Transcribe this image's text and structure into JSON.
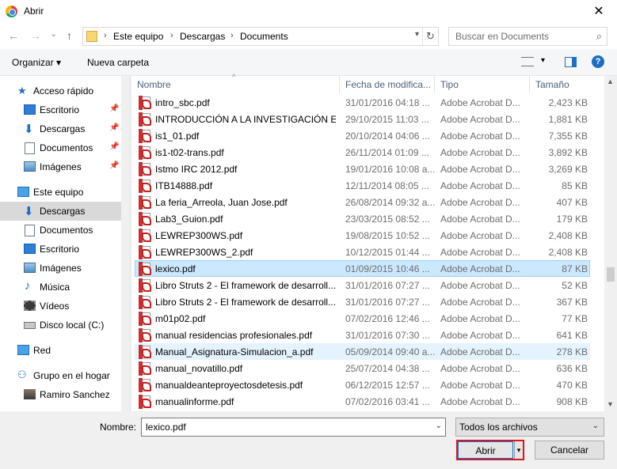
{
  "window": {
    "title": "Abrir",
    "close_glyph": "✕"
  },
  "nav": {
    "back_glyph": "←",
    "forward_glyph": "→",
    "recent_glyph": "⌄",
    "up_glyph": "↑",
    "breadcrumb": [
      "Este equipo",
      "Descargas",
      "Documents"
    ],
    "refresh_glyph": "↻",
    "search_placeholder": "Buscar en Documents"
  },
  "toolbar": {
    "organize_label": "Organizar ▾",
    "new_folder_label": "Nueva carpeta",
    "help_glyph": "?"
  },
  "sidebar": {
    "quick_access": "Acceso rápido",
    "quick_items": [
      "Escritorio",
      "Descargas",
      "Documentos",
      "Imágenes"
    ],
    "this_pc": "Este equipo",
    "pc_items": [
      "Descargas",
      "Documentos",
      "Escritorio",
      "Imágenes",
      "Música",
      "Vídeos",
      "Disco local (C:)"
    ],
    "network": "Red",
    "homegroup": "Grupo en el hogar",
    "user": "Ramiro Sanchez"
  },
  "columns": {
    "name": "Nombre",
    "date": "Fecha de modifica...",
    "type": "Tipo",
    "size": "Tamaño"
  },
  "files": [
    {
      "name": "intro_sbc.pdf",
      "date": "31/01/2016 04:18 ...",
      "type": "Adobe Acrobat D...",
      "size": "2,423 KB"
    },
    {
      "name": "INTRODUCCIÓN A LA INVESTIGACIÓN E...",
      "date": "29/10/2015 11:03 ...",
      "type": "Adobe Acrobat D...",
      "size": "1,881 KB"
    },
    {
      "name": "is1_01.pdf",
      "date": "20/10/2014 04:06 ...",
      "type": "Adobe Acrobat D...",
      "size": "7,355 KB"
    },
    {
      "name": "is1-t02-trans.pdf",
      "date": "26/11/2014 01:09 ...",
      "type": "Adobe Acrobat D...",
      "size": "3,892 KB"
    },
    {
      "name": "Istmo IRC 2012.pdf",
      "date": "19/01/2016 10:08 a...",
      "type": "Adobe Acrobat D...",
      "size": "3,269 KB"
    },
    {
      "name": "ITB14888.pdf",
      "date": "12/11/2014 08:05 ...",
      "type": "Adobe Acrobat D...",
      "size": "85 KB"
    },
    {
      "name": "La feria_Arreola, Juan Jose.pdf",
      "date": "26/08/2014 09:32 a...",
      "type": "Adobe Acrobat D...",
      "size": "407 KB"
    },
    {
      "name": "Lab3_Guion.pdf",
      "date": "23/03/2015 08:52 ...",
      "type": "Adobe Acrobat D...",
      "size": "179 KB"
    },
    {
      "name": "LEWREP300WS.pdf",
      "date": "19/08/2015 10:52 ...",
      "type": "Adobe Acrobat D...",
      "size": "2,408 KB"
    },
    {
      "name": "LEWREP300WS_2.pdf",
      "date": "10/12/2015 01:44 ...",
      "type": "Adobe Acrobat D...",
      "size": "2,408 KB"
    },
    {
      "name": "lexico.pdf",
      "date": "01/09/2015 10:46 ...",
      "type": "Adobe Acrobat D...",
      "size": "87 KB"
    },
    {
      "name": "Libro Struts 2 - El framework de desarroll...",
      "date": "31/01/2016 07:27 ...",
      "type": "Adobe Acrobat D...",
      "size": "52 KB"
    },
    {
      "name": "Libro Struts 2 - El framework de desarroll...",
      "date": "31/01/2016 07:27 ...",
      "type": "Adobe Acrobat D...",
      "size": "367 KB"
    },
    {
      "name": "m01p02.pdf",
      "date": "07/02/2016 12:46 ...",
      "type": "Adobe Acrobat D...",
      "size": "77 KB"
    },
    {
      "name": "manual residencias profesionales.pdf",
      "date": "31/01/2016 07:30 ...",
      "type": "Adobe Acrobat D...",
      "size": "641 KB"
    },
    {
      "name": "Manual_Asignatura-Simulacion_a.pdf",
      "date": "05/09/2014 09:40 a...",
      "type": "Adobe Acrobat D...",
      "size": "278 KB"
    },
    {
      "name": "manual_novatillo.pdf",
      "date": "25/07/2014 04:38 ...",
      "type": "Adobe Acrobat D...",
      "size": "636 KB"
    },
    {
      "name": "manualdeanteproyectosdetesis.pdf",
      "date": "06/12/2015 12:57 ...",
      "type": "Adobe Acrobat D...",
      "size": "470 KB"
    },
    {
      "name": "manualinforme.pdf",
      "date": "07/02/2016 03:41 ...",
      "type": "Adobe Acrobat D...",
      "size": "908 KB"
    }
  ],
  "selected_index": 10,
  "hover_index": 15,
  "footer": {
    "name_label": "Nombre:",
    "name_value": "lexico.pdf",
    "filter_value": "Todos los archivos",
    "open_label": "Abrir",
    "cancel_label": "Cancelar"
  },
  "colors": {
    "selection": "#cce8ff",
    "hover": "#e5f3ff",
    "accent": "#0078d7",
    "highlight_border": "#e0141e"
  }
}
